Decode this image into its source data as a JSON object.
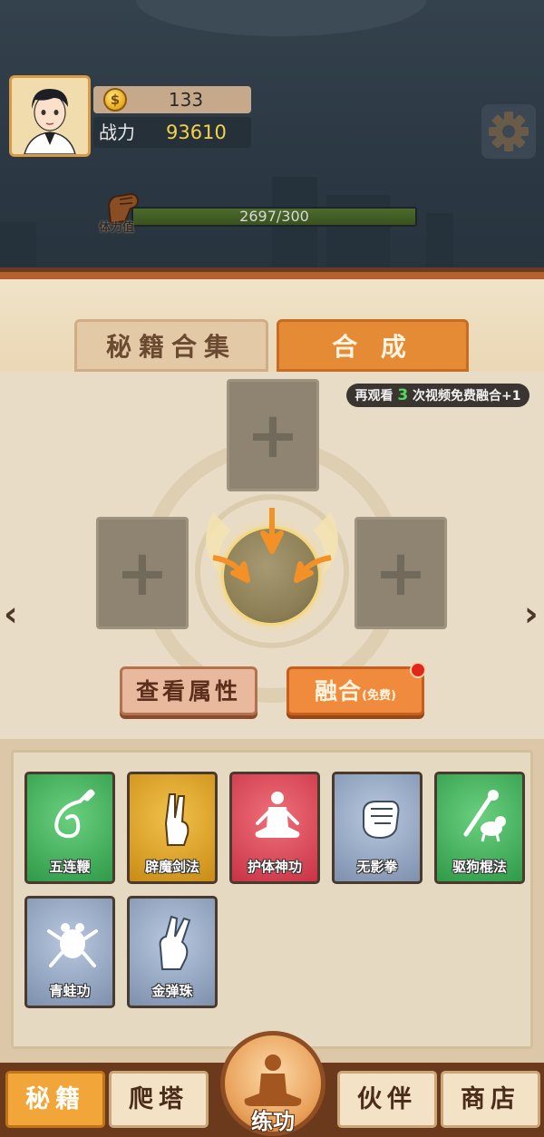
{
  "header": {
    "coins": "133",
    "power_label": "战力",
    "power_value": "93610",
    "stamina_label": "体力值",
    "stamina_text": "2697/300",
    "stamina_fraction": 1.0
  },
  "tabs": [
    {
      "label": "秘籍合集",
      "active": false
    },
    {
      "label": "合 成",
      "active": true
    }
  ],
  "fusion": {
    "hint_prefix": "再观看",
    "hint_count": "3",
    "hint_suffix": "次视频免费融合+1",
    "view_attr_label": "查看属性",
    "fuse_label": "融合",
    "fuse_free_label": "(免费)"
  },
  "cards": [
    {
      "label": "五连鞭",
      "color": "green",
      "icon": "whip-icon"
    },
    {
      "label": "辟魔剑法",
      "color": "gold",
      "icon": "sword-hand-icon"
    },
    {
      "label": "护体神功",
      "color": "red",
      "icon": "meditation-icon"
    },
    {
      "label": "无影拳",
      "color": "blue",
      "icon": "fist-icon"
    },
    {
      "label": "驱狗棍法",
      "color": "green",
      "icon": "stick-dog-icon"
    },
    {
      "label": "青蛙功",
      "color": "blue",
      "icon": "frog-icon"
    },
    {
      "label": "金弹珠",
      "color": "blue",
      "icon": "flick-hand-icon"
    }
  ],
  "nav": {
    "secret_books": "秘籍",
    "tower": "爬塔",
    "training": "练功",
    "partner": "伙伴",
    "shop": "商店"
  },
  "colors": {
    "accent_orange": "#e58a35",
    "panel_bg": "#dcc8a8",
    "stamina_green": "#4d6a2c"
  }
}
